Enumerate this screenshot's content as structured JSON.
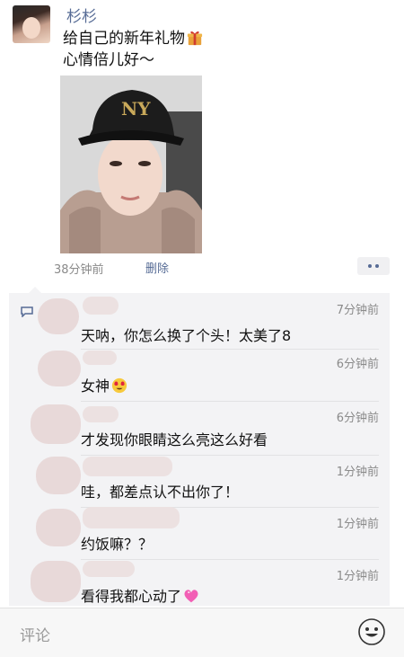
{
  "post": {
    "author": "杉杉",
    "text_line1": "给自己的新年礼物",
    "text_line2": "心情倍儿好～",
    "time": "38分钟前",
    "delete_label": "删除"
  },
  "comments": [
    {
      "time": "7分钟前",
      "text": "天呐，你怎么换了个头！太美了8",
      "emoji": ""
    },
    {
      "time": "6分钟前",
      "text": "女神",
      "emoji": "heart-eyes-emoji"
    },
    {
      "time": "6分钟前",
      "text": "才发现你眼睛这么亮这么好看",
      "emoji": ""
    },
    {
      "time": "1分钟前",
      "text": "哇，都差点认不出你了！",
      "emoji": ""
    },
    {
      "time": "1分钟前",
      "text": "约饭嘛？？",
      "emoji": ""
    },
    {
      "time": "1分钟前",
      "text": "看得我都心动了",
      "emoji": "pink-heart-emoji"
    }
  ],
  "input": {
    "placeholder": "评论"
  },
  "icons": {
    "gift": "gift-icon",
    "comment": "comment-bubble-icon",
    "more": "more-dots-icon",
    "emoji": "smiley-face-icon"
  },
  "colors": {
    "link": "#566b95",
    "time": "#8a8a8a",
    "panel": "#f3f3f5"
  }
}
